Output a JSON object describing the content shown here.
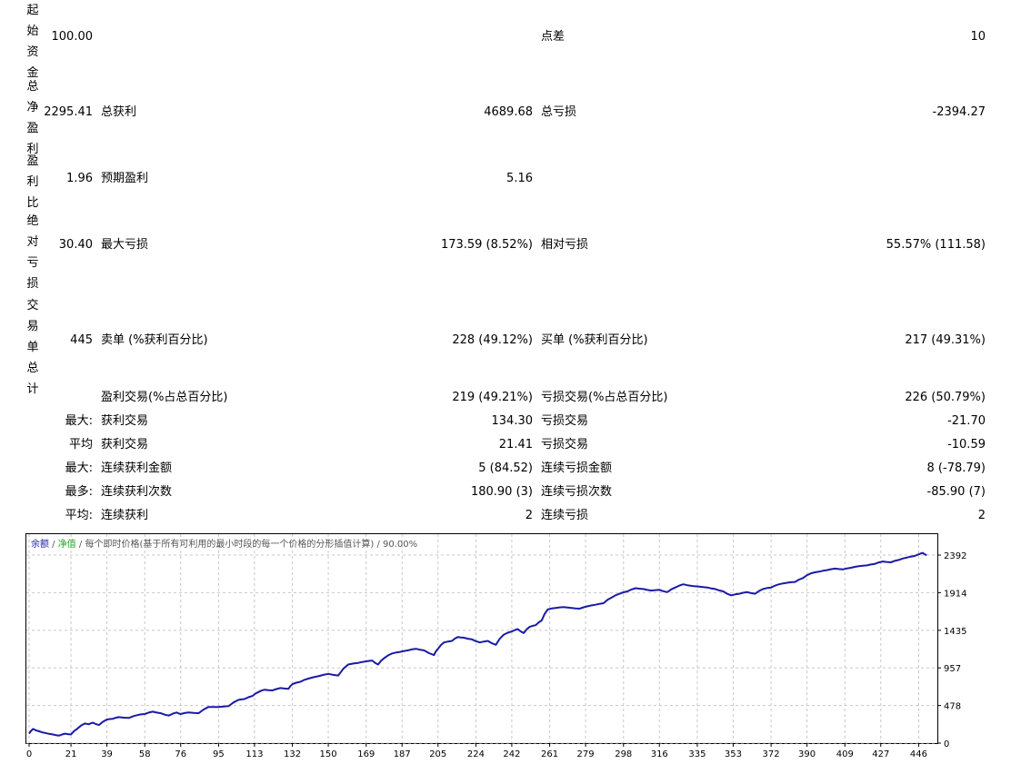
{
  "stats": {
    "initial_deposit": {
      "label": "起始资金",
      "value": "100.00"
    },
    "spread": {
      "label": "点差",
      "value": "10"
    },
    "net_profit": {
      "label": "总净盈利",
      "value": "2295.41"
    },
    "gross_profit": {
      "label": "总获利",
      "value": "4689.68"
    },
    "gross_loss": {
      "label": "总亏损",
      "value": "-2394.27"
    },
    "profit_factor": {
      "label": "盈利比",
      "value": "1.96"
    },
    "expected_payoff": {
      "label": "预期盈利",
      "value": "5.16"
    },
    "absolute_drawdown": {
      "label": "绝对亏损",
      "value": "30.40"
    },
    "max_drawdown": {
      "label": "最大亏损",
      "value": "173.59 (8.52%)"
    },
    "relative_drawdown": {
      "label": "相对亏损",
      "value": "55.57% (111.58)"
    },
    "total_trades": {
      "label": "交易单总计",
      "value": "445"
    },
    "short_positions": {
      "label": "卖单 (%获利百分比)",
      "value": "228 (49.12%)"
    },
    "long_positions": {
      "label": "买单 (%获利百分比)",
      "value": "217 (49.31%)"
    },
    "profit_trades": {
      "label": "盈利交易(%占总百分比)",
      "value": "219 (49.21%)"
    },
    "loss_trades": {
      "label": "亏损交易(%占总百分比)",
      "value": "226 (50.79%)"
    },
    "largest": {
      "prefix": "最大:",
      "profit_label": "获利交易",
      "profit_value": "134.30",
      "loss_label": "亏损交易",
      "loss_value": "-21.70"
    },
    "average": {
      "prefix": "平均",
      "profit_label": "获利交易",
      "profit_value": "21.41",
      "loss_label": "亏损交易",
      "loss_value": "-10.59"
    },
    "max_consecutive": {
      "prefix": "最大:",
      "wins_label": "连续获利金额",
      "wins_value": "5 (84.52)",
      "losses_label": "连续亏损金额",
      "losses_value": "8 (-78.79)"
    },
    "max_consecutive_amount": {
      "prefix": "最多:",
      "wins_label": "连续获利次数",
      "wins_value": "180.90 (3)",
      "losses_label": "连续亏损次数",
      "losses_value": "-85.90 (7)"
    },
    "avg_consecutive": {
      "prefix": "平均:",
      "wins_label": "连续获利",
      "wins_value": "2",
      "losses_label": "连续亏损",
      "losses_value": "2"
    }
  },
  "colors": {
    "balance_line": "#1a1aa6",
    "equity_line": "#2fb52f",
    "grid": "#c8c8c8",
    "legend_balance": "#1a1aa6",
    "legend_equity": "#21a421",
    "legend_text": "#555555"
  },
  "chart_data": {
    "type": "line",
    "legend": {
      "balance": "余额",
      "sep1": " / ",
      "equity": "净值",
      "sep2": " / ",
      "model": "每个即时价格(基于所有可利用的最小时段的每一个价格的分形插值计算)",
      "sep3": " / ",
      "quality": "90.00%"
    },
    "x_ticks": [
      "0",
      "21",
      "39",
      "58",
      "76",
      "95",
      "113",
      "132",
      "150",
      "169",
      "187",
      "205",
      "224",
      "242",
      "261",
      "279",
      "298",
      "316",
      "335",
      "353",
      "372",
      "390",
      "409",
      "427",
      "446"
    ],
    "y_ticks": [
      "0",
      "478",
      "957",
      "1435",
      "1914",
      "2392"
    ],
    "xlim": [
      0,
      454
    ],
    "ylim": [
      0,
      2392
    ],
    "series": [
      {
        "key": "balance",
        "x": [
          0,
          2,
          5,
          8,
          12,
          15,
          18,
          21,
          24,
          28,
          30,
          32,
          35,
          39,
          42,
          45,
          50,
          55,
          58,
          62,
          66,
          70,
          74,
          76,
          80,
          85,
          90,
          95,
          100,
          105,
          108,
          112,
          115,
          118,
          122,
          126,
          130,
          132,
          136,
          140,
          145,
          150,
          155,
          160,
          165,
          169,
          172,
          175,
          178,
          182,
          186,
          190,
          194,
          198,
          203,
          205,
          208,
          212,
          215,
          218,
          222,
          226,
          230,
          234,
          238,
          242,
          245,
          248,
          251,
          254,
          257,
          260,
          264,
          268,
          272,
          276,
          280,
          284,
          288,
          292,
          296,
          300,
          304,
          308,
          312,
          316,
          320,
          324,
          328,
          332,
          336,
          340,
          344,
          348,
          352,
          356,
          360,
          364,
          368,
          372,
          376,
          380,
          384,
          388,
          392,
          396,
          400,
          404,
          408,
          412,
          416,
          420,
          424,
          428,
          432,
          436,
          440,
          444,
          446,
          448,
          450
        ],
        "y": [
          120,
          180,
          150,
          130,
          110,
          95,
          120,
          110,
          180,
          250,
          240,
          260,
          230,
          300,
          310,
          330,
          320,
          360,
          370,
          400,
          380,
          350,
          390,
          370,
          390,
          380,
          460,
          460,
          470,
          550,
          560,
          600,
          650,
          680,
          670,
          700,
          690,
          750,
          780,
          820,
          850,
          880,
          860,
          1000,
          1020,
          1040,
          1050,
          1000,
          1080,
          1140,
          1160,
          1180,
          1200,
          1180,
          1120,
          1200,
          1280,
          1300,
          1350,
          1340,
          1320,
          1280,
          1300,
          1250,
          1380,
          1420,
          1450,
          1400,
          1480,
          1500,
          1560,
          1700,
          1720,
          1730,
          1720,
          1710,
          1740,
          1760,
          1780,
          1850,
          1900,
          1930,
          1970,
          1960,
          1940,
          1950,
          1920,
          1980,
          2020,
          2000,
          1990,
          1980,
          1960,
          1930,
          1880,
          1900,
          1920,
          1900,
          1960,
          1980,
          2020,
          2040,
          2050,
          2100,
          2160,
          2180,
          2200,
          2220,
          2210,
          2230,
          2250,
          2260,
          2280,
          2310,
          2300,
          2330,
          2360,
          2380,
          2400,
          2420,
          2390
        ]
      }
    ]
  }
}
